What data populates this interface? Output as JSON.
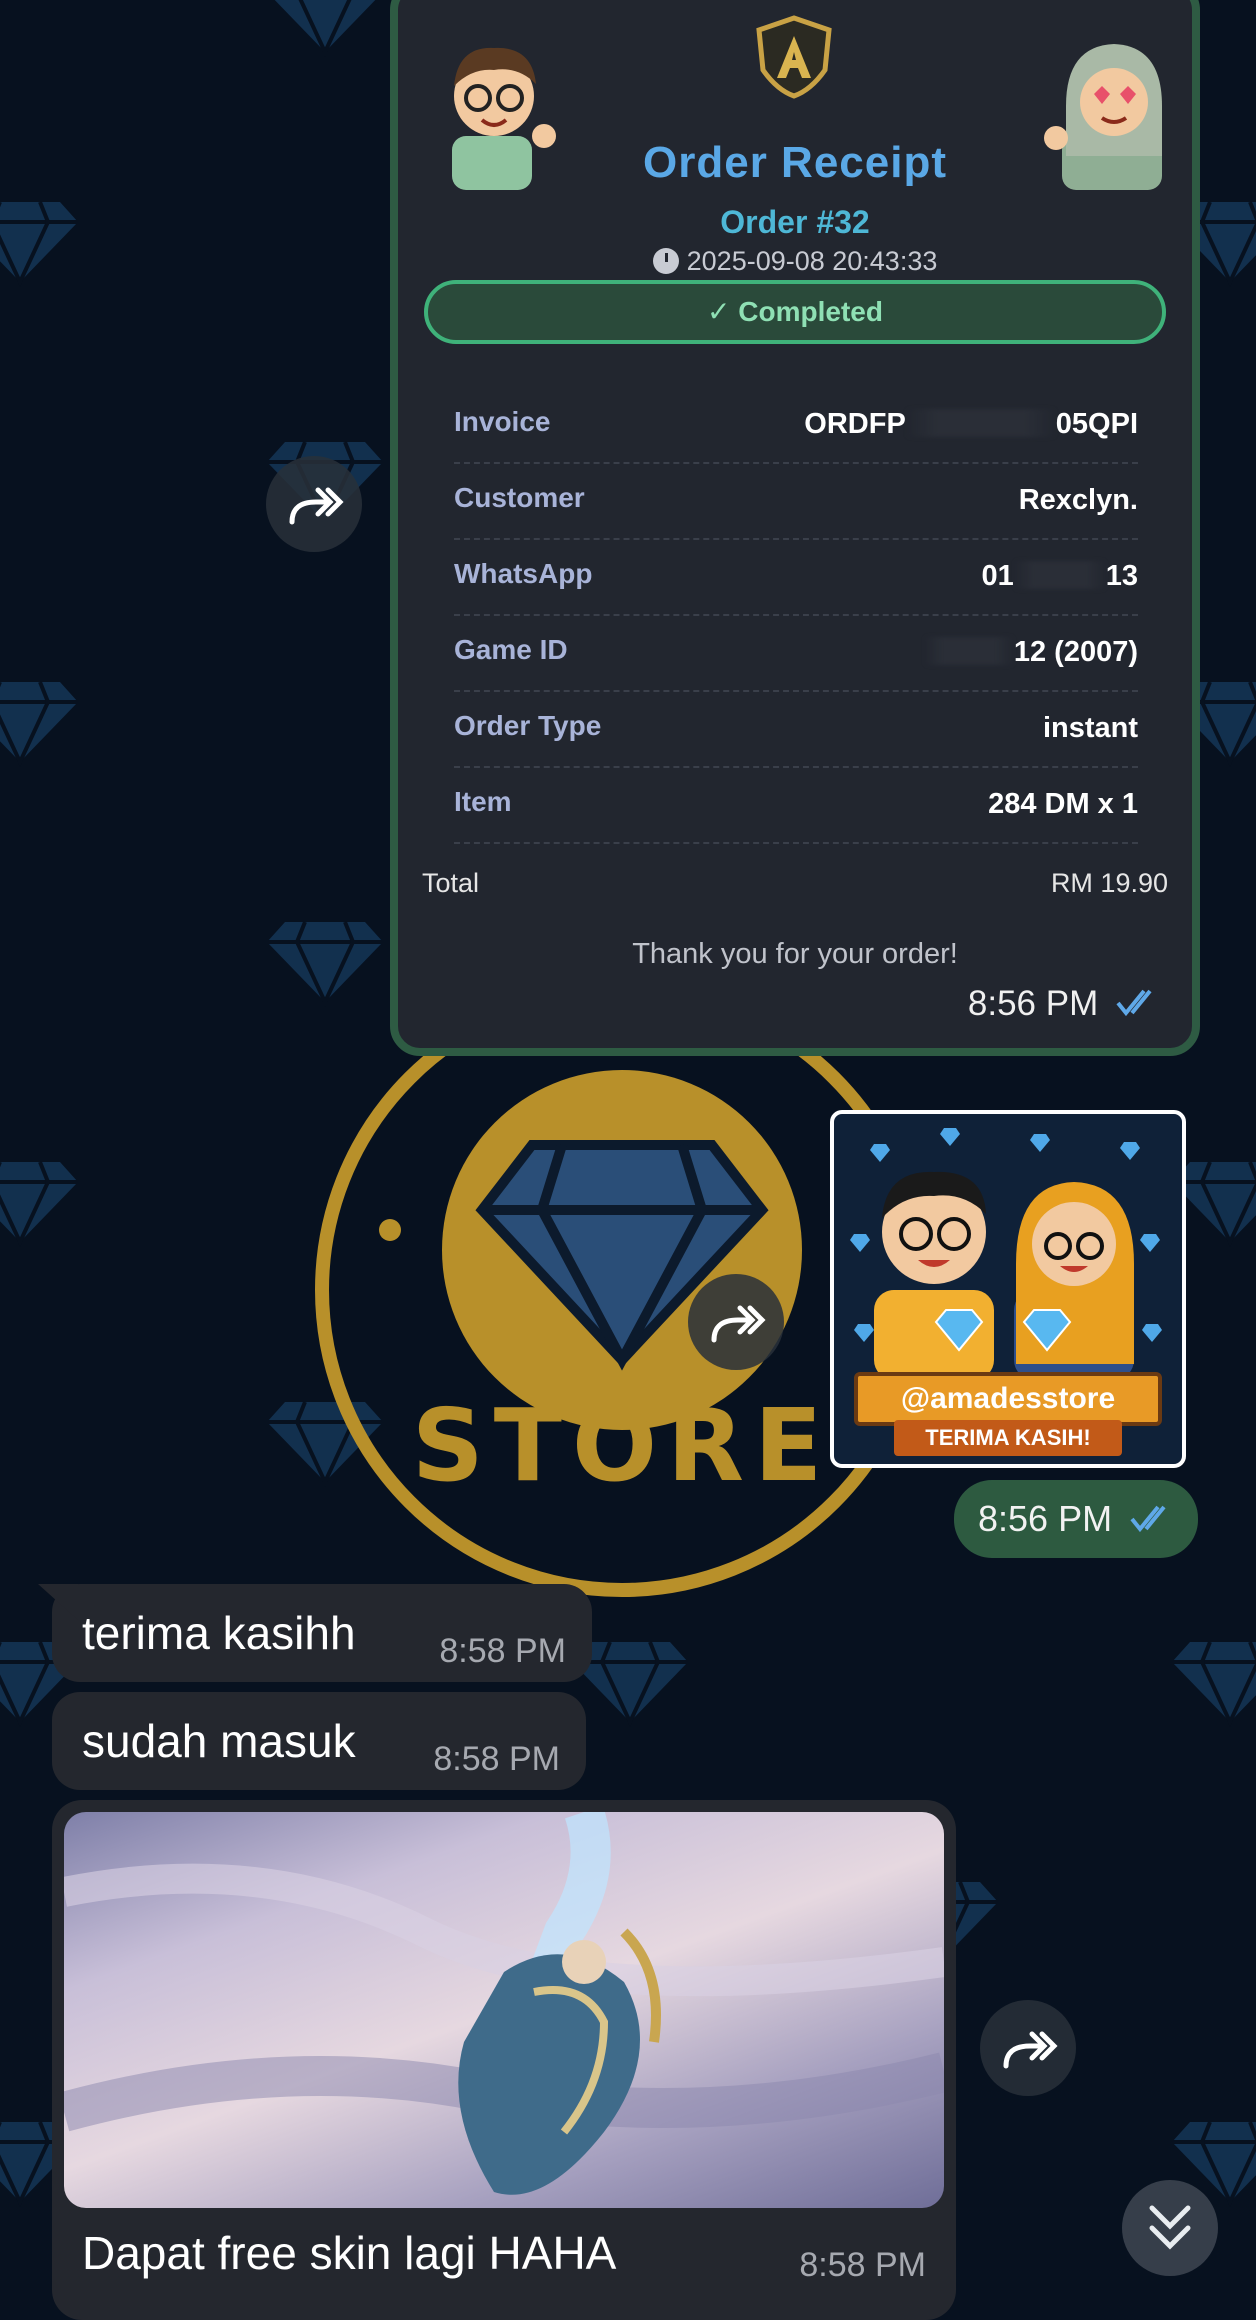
{
  "receipt": {
    "title": "Order Receipt",
    "order_number": "Order #32",
    "datetime": "2025-09-08 20:43:33",
    "status": "✓ Completed",
    "rows": [
      {
        "label": "Invoice",
        "value_start": "ORDFP",
        "value_end": "05QPI"
      },
      {
        "label": "Customer",
        "value": "Rexclyn."
      },
      {
        "label": "WhatsApp",
        "value_start": "01",
        "value_end": "13"
      },
      {
        "label": "Game ID",
        "value_end": "12 (2007)"
      },
      {
        "label": "Order Type",
        "value": "instant"
      },
      {
        "label": "Item",
        "value": "284 DM x 1"
      }
    ],
    "total_label": "Total",
    "total_value": "RM 19.90",
    "thanks": "Thank you for your order!",
    "time": "8:56 PM"
  },
  "sticker": {
    "handle": "@amadesstore",
    "subtitle": "TERIMA KASIH!",
    "time": "8:56 PM"
  },
  "background_logo": {
    "text_bottom": "STORE"
  },
  "messages": [
    {
      "text": "terima kasihh",
      "time": "8:58 PM"
    },
    {
      "text": "sudah masuk",
      "time": "8:58 PM"
    }
  ],
  "media_message": {
    "caption": "Dapat free skin lagi HAHA",
    "time": "8:58 PM"
  },
  "colors": {
    "background": "#07111f",
    "outgoing_bubble": "#2d5a40",
    "incoming_bubble": "#24272e",
    "read_ticks": "#5fa8e8",
    "accent_title": "#5aa8e6"
  }
}
